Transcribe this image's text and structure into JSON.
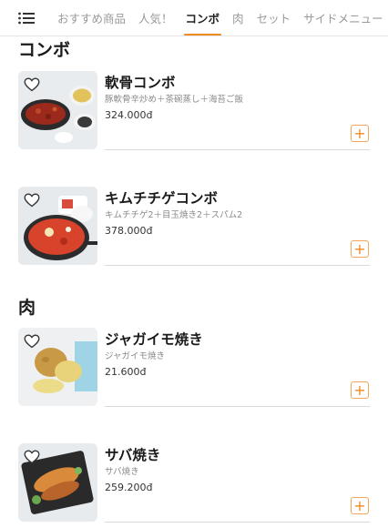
{
  "nav": {
    "menu_icon": "hamburger-list-icon",
    "tabs": [
      {
        "label": "おすすめ商品",
        "active": false
      },
      {
        "label": "人気！",
        "active": false
      },
      {
        "label": "コンボ",
        "active": true
      },
      {
        "label": "肉",
        "active": false
      },
      {
        "label": "セット",
        "active": false
      },
      {
        "label": "サイドメニュー",
        "active": false
      }
    ]
  },
  "colors": {
    "accent": "#f08a24",
    "text": "#1a1a1a",
    "muted": "#8a8a8a",
    "divider": "#d9d9d9"
  },
  "sections": [
    {
      "title": "コンボ",
      "items": [
        {
          "name": "軟骨コンボ",
          "desc": "豚軟骨辛炒め＋茶碗蒸し＋海苔ご飯",
          "price": "324.000đ",
          "image": "stir-fried-cartilage-combo-photo"
        },
        {
          "name": "キムチチゲコンボ",
          "desc": "キムチチゲ2＋目玉焼き2＋スパム2",
          "price": "378.000đ",
          "image": "kimchi-stew-combo-photo"
        }
      ]
    },
    {
      "title": "肉",
      "items": [
        {
          "name": "ジャガイモ焼き",
          "desc": "ジャガイモ焼き",
          "price": "21.600đ",
          "image": "grilled-potato-photo"
        },
        {
          "name": "サバ焼き",
          "desc": "サバ焼き",
          "price": "259.200đ",
          "image": "grilled-mackerel-photo"
        }
      ]
    }
  ],
  "icons": {
    "favorite": "heart-outline-icon",
    "add": "plus-icon"
  }
}
